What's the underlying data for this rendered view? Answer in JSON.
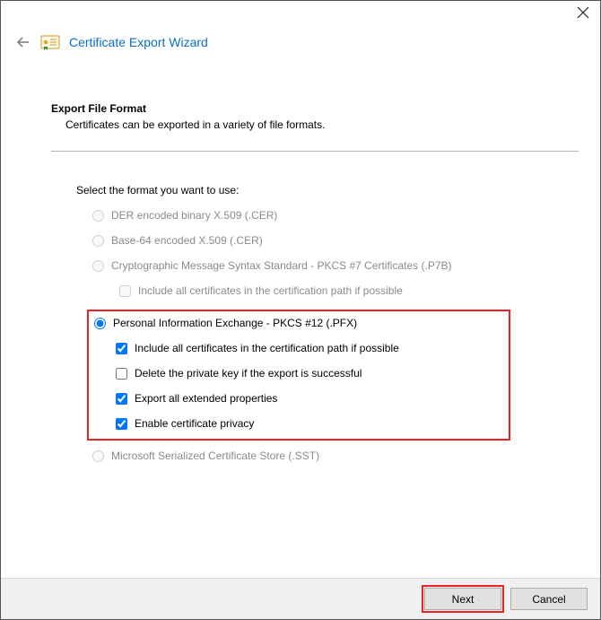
{
  "wizard": {
    "title": "Certificate Export Wizard"
  },
  "section": {
    "title": "Export File Format",
    "subtitle": "Certificates can be exported in a variety of file formats."
  },
  "prompt": "Select the format you want to use:",
  "options": {
    "der": "DER encoded binary X.509 (.CER)",
    "base64": "Base-64 encoded X.509 (.CER)",
    "pkcs7": "Cryptographic Message Syntax Standard - PKCS #7 Certificates (.P7B)",
    "pkcs7_include": "Include all certificates in the certification path if possible",
    "pfx": "Personal Information Exchange - PKCS #12 (.PFX)",
    "pfx_include": "Include all certificates in the certification path if possible",
    "pfx_delete": "Delete the private key if the export is successful",
    "pfx_extended": "Export all extended properties",
    "pfx_privacy": "Enable certificate privacy",
    "sst": "Microsoft Serialized Certificate Store (.SST)"
  },
  "buttons": {
    "next": "Next",
    "cancel": "Cancel"
  }
}
